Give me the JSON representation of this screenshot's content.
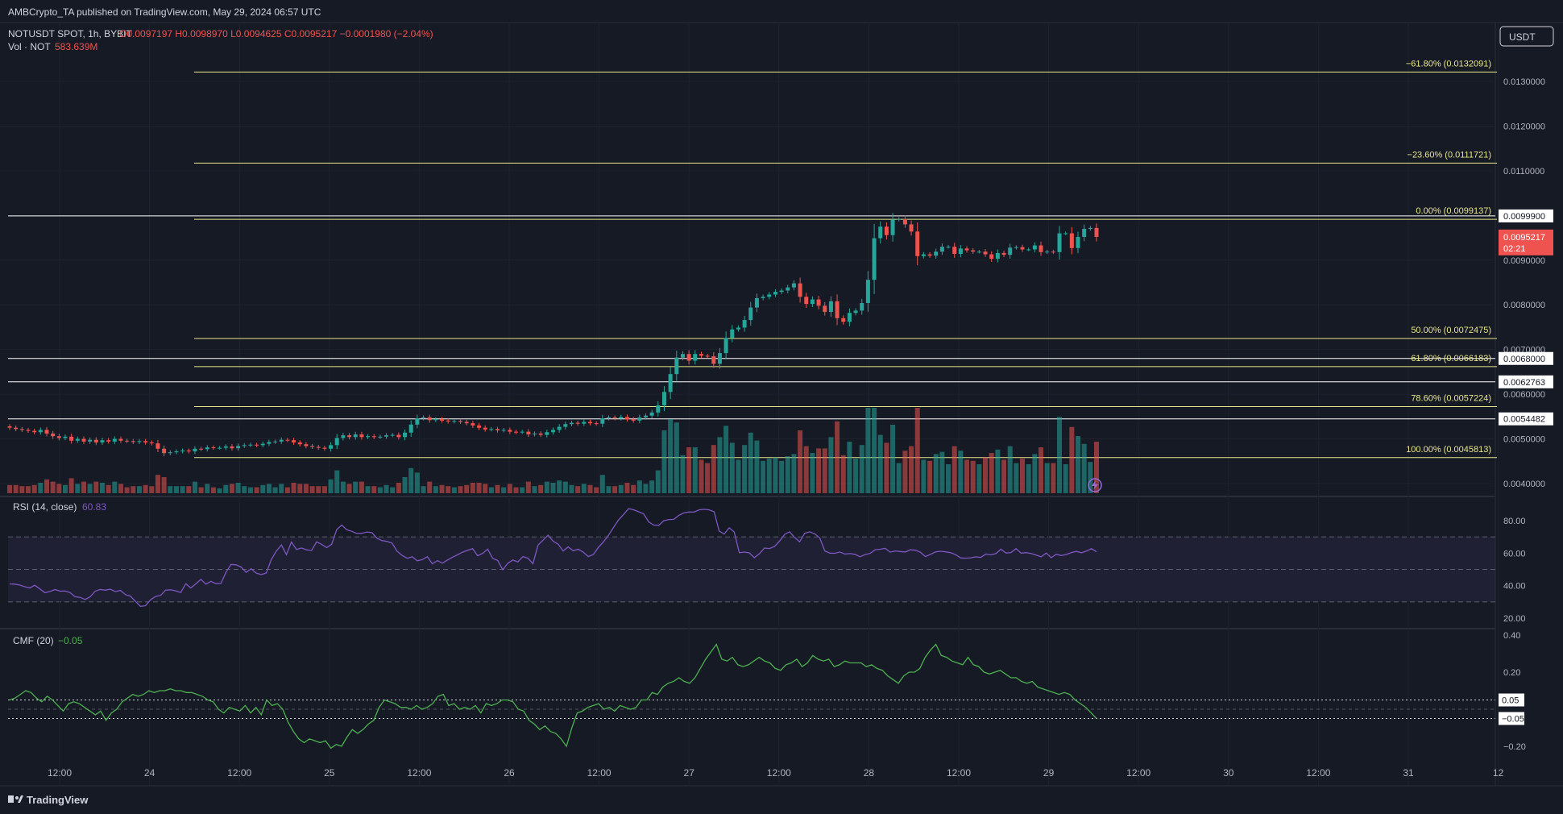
{
  "header": {
    "publisher": "AMBCrypto_TA published on TradingView.com, May 29, 2024 06:57 UTC",
    "symbol": "NOTUSDT SPOT, 1h, BYBIT",
    "ohlc": "O0.0097197 H0.0098970 L0.0094625 C0.0095217 −0.0001980 (−2.04%)",
    "vol_label": "Vol · NOT",
    "vol_value": "583.639M"
  },
  "currency": "USDT",
  "footer_brand": "TradingView",
  "colors": {
    "up": "#26a69a",
    "down": "#ef5350",
    "fib": "#e8e68a",
    "rsi": "#7e57c2",
    "cmf": "#4caf50",
    "bg": "#161a25"
  },
  "chart_data": [
    {
      "type": "candlestick",
      "title": "NOTUSDT SPOT, 1h, BYBIT",
      "y_ticks": [
        "0.0130000",
        "0.0120000",
        "0.0110000",
        "0.0090000",
        "0.0080000",
        "0.0070000",
        "0.0060000",
        "0.0050000",
        "0.0040000"
      ],
      "x_ticks": [
        "12:00",
        "24",
        "12:00",
        "25",
        "12:00",
        "26",
        "12:00",
        "27",
        "12:00",
        "28",
        "12:00",
        "29",
        "12:00",
        "30",
        "12:00",
        "31",
        "12"
      ],
      "current_price": "0.0095217",
      "countdown": "02:21",
      "price_levels": [
        "0.0099900",
        "0.0068000",
        "0.0062763",
        "0.0054482"
      ],
      "fib_levels": [
        {
          "label": "−61.80% (0.0132091)",
          "price": 0.0132091
        },
        {
          "label": "−23.60% (0.0111721)",
          "price": 0.0111721
        },
        {
          "label": "0.00% (0.0099137)",
          "price": 0.0099137
        },
        {
          "label": "50.00% (0.0072475)",
          "price": 0.0072475
        },
        {
          "label": "61.80% (0.0066183)",
          "price": 0.0066183
        },
        {
          "label": "78.60% (0.0057224)",
          "price": 0.0057224
        },
        {
          "label": "100.00% (0.0045813)",
          "price": 0.0045813
        }
      ],
      "closes": [
        0.00525,
        0.00522,
        0.0052,
        0.00518,
        0.00515,
        0.0052,
        0.00512,
        0.00506,
        0.00502,
        0.00505,
        0.00496,
        0.005,
        0.00494,
        0.00498,
        0.00492,
        0.00497,
        0.00494,
        0.005,
        0.00496,
        0.00495,
        0.00493,
        0.00495,
        0.00492,
        0.0049,
        0.00478,
        0.00468,
        0.0047,
        0.00472,
        0.00474,
        0.00472,
        0.00478,
        0.00477,
        0.00481,
        0.0048,
        0.0048,
        0.00483,
        0.00479,
        0.00484,
        0.00486,
        0.00487,
        0.00486,
        0.00489,
        0.00493,
        0.00494,
        0.00498,
        0.00497,
        0.00492,
        0.00488,
        0.00484,
        0.00482,
        0.0048,
        0.00478,
        0.00486,
        0.00502,
        0.00508,
        0.00504,
        0.0051,
        0.00504,
        0.00506,
        0.00504,
        0.00505,
        0.00508,
        0.00509,
        0.00504,
        0.00514,
        0.00532,
        0.00546,
        0.00548,
        0.00542,
        0.00544,
        0.00541,
        0.00539,
        0.0054,
        0.00538,
        0.00535,
        0.0053,
        0.00525,
        0.00521,
        0.00522,
        0.00519,
        0.0052,
        0.00516,
        0.00515,
        0.00516,
        0.0051,
        0.00512,
        0.00509,
        0.00515,
        0.0052,
        0.00527,
        0.00533,
        0.00536,
        0.00534,
        0.00538,
        0.00535,
        0.00534,
        0.00546,
        0.00548,
        0.00546,
        0.00549,
        0.00544,
        0.00541,
        0.00548,
        0.00552,
        0.00559,
        0.00575,
        0.00605,
        0.00645,
        0.00682,
        0.0069,
        0.00675,
        0.0069,
        0.00686,
        0.00685,
        0.00668,
        0.00692,
        0.00726,
        0.00745,
        0.00749,
        0.00766,
        0.00794,
        0.00815,
        0.00818,
        0.00823,
        0.00829,
        0.00832,
        0.00839,
        0.00848,
        0.00818,
        0.00802,
        0.00812,
        0.00798,
        0.00784,
        0.00808,
        0.0077,
        0.00762,
        0.00782,
        0.00787,
        0.00804,
        0.00856,
        0.00949,
        0.00975,
        0.00956,
        0.00991,
        0.00992,
        0.0098,
        0.00964,
        0.00909,
        0.00913,
        0.0091,
        0.00919,
        0.0093,
        0.0093,
        0.00914,
        0.00926,
        0.00922,
        0.00919,
        0.00919,
        0.00913,
        0.00903,
        0.00916,
        0.00912,
        0.00928,
        0.00929,
        0.00924,
        0.00924,
        0.00933,
        0.00918,
        0.00919,
        0.00918,
        0.0096,
        0.0096,
        0.00927,
        0.00952,
        0.0097,
        0.00972,
        0.00952
      ],
      "rsi": {
        "label": "RSI (14, close)",
        "value": "60.83",
        "y_ticks": [
          "80.00",
          "60.00",
          "40.00",
          "20.00"
        ],
        "values": [
          41.06,
          40.92,
          40.4,
          39.33,
          38.6,
          40.24,
          37.99,
          35.69,
          36.42,
          37.6,
          36.61,
          36.71,
          35.71,
          33.2,
          32.78,
          31.52,
          33.12,
          36.59,
          37.64,
          37.23,
          37.82,
          36.33,
          37.12,
          34.54,
          33.55,
          30.32,
          27.22,
          27.68,
          31.36,
          33.32,
          34.05,
          37.24,
          37.46,
          36.83,
          35.78,
          41.21,
          38.59,
          41.14,
          43.85,
          40.91,
          42.68,
          41.21,
          41.41,
          48.34,
          53.08,
          52.85,
          51.42,
          48.2,
          50.4,
          47.74,
          46.82,
          47.77,
          56.12,
          61.29,
          65.03,
          59.08,
          66.83,
          62.3,
          63.2,
          62.04,
          61.61,
          66.94,
          65.42,
          63.38,
          65.48,
          74.49,
          77.28,
          74.42,
          73.4,
          72.09,
          72.21,
          73.0,
          72.62,
          69.21,
          67.68,
          67.23,
          66.15,
          61.18,
          58.56,
          56.84,
          57.72,
          55.31,
          55.98,
          57.85,
          53.45,
          55.41,
          53.81,
          55.77,
          57.48,
          59.0,
          60.62,
          61.68,
          62.77,
          58.45,
          59.87,
          62.45,
          56.75,
          55.47,
          49.8,
          53.79,
          55.76,
          54.61,
          57.9,
          56.89,
          53.51,
          64.97,
          67.98,
          71.06,
          67.36,
          65.58,
          61.34,
          63.85,
          61.47,
          62.41,
          60.59,
          57.86,
          59.18,
          63.52,
          66.87,
          70.91,
          75.73,
          80.39,
          83.77,
          87.38,
          86.69,
          85.43,
          84.15,
          79.27,
          77.26,
          77.14,
          79.94,
          80.71,
          80.8,
          83.25,
          84.76,
          85.33,
          85.26,
          86.64,
          87.0,
          86.63,
          85.47,
          73.63,
          71.7,
          75.58,
          73.04,
          60.27,
          60.68,
          60.19,
          57.2,
          59.69,
          63.12,
          62.86,
          64.09,
          67.35,
          71.5,
          73.16,
          69.68,
          66.98,
          72.22,
          73.1,
          71.86,
          69.34,
          61.37,
          60.03,
          59.94,
          60.7,
          59.43,
          59.72,
          59.29,
          57.77,
          59.1,
          59.84,
          62.08,
          62.38,
          62.92,
          60.63,
          61.37,
          61.02,
          60.72,
          62.03,
          61.81,
          60.57,
          57.88,
          59.29,
          60.76,
          61.15,
          60.81,
          60.24,
          59.06,
          57.06,
          56.89,
          57.15,
          57.75,
          57.38,
          59.46,
          58.99,
          59.74,
          62.39,
          60.07,
          60.35,
          62.8,
          60.0,
          60.3,
          59.82,
          58.79,
          57.74,
          60.05,
          57.26,
          59.34,
          58.51,
          59.15,
          60.36,
          61.13,
          60.21,
          61.28,
          62.73,
          60.83
        ]
      },
      "cmf": {
        "label": "CMF (20)",
        "value": "−0.05",
        "y_ticks": [
          "0.40",
          "0.20",
          "−0.20"
        ],
        "level_labels": [
          "0.05",
          "−0.05"
        ],
        "values": [
          0.05,
          0.06,
          0.08,
          0.1,
          0.09,
          0.06,
          0.04,
          0.07,
          0.05,
          0.02,
          -0.01,
          0.03,
          0.04,
          0.03,
          0.01,
          -0.01,
          -0.03,
          -0.01,
          -0.06,
          -0.02,
          0.0,
          0.04,
          0.06,
          0.08,
          0.07,
          0.08,
          0.1,
          0.09,
          0.1,
          0.1,
          0.11,
          0.1,
          0.1,
          0.09,
          0.09,
          0.08,
          0.07,
          0.05,
          0.04,
          0.0,
          -0.02,
          0.01,
          0.0,
          -0.01,
          0.02,
          -0.02,
          0.01,
          -0.03,
          0.05,
          0.02,
          0.03,
          0.0,
          -0.07,
          -0.12,
          -0.16,
          -0.18,
          -0.16,
          -0.17,
          -0.18,
          -0.17,
          -0.21,
          -0.19,
          -0.2,
          -0.15,
          -0.11,
          -0.13,
          -0.11,
          -0.08,
          -0.06,
          0.01,
          0.05,
          0.04,
          0.03,
          0.01,
          0.01,
          0.0,
          0.02,
          0.0,
          0.01,
          0.03,
          0.07,
          0.08,
          0.02,
          0.03,
          0.0,
          0.01,
          0.0,
          0.02,
          -0.02,
          0.03,
          0.02,
          0.03,
          0.05,
          0.05,
          0.04,
          0.0,
          -0.01,
          -0.06,
          -0.08,
          -0.11,
          -0.09,
          -0.12,
          -0.13,
          -0.16,
          -0.2,
          -0.1,
          -0.02,
          -0.01,
          0.01,
          0.02,
          0.03,
          0.0,
          0.01,
          -0.01,
          0.02,
          0.01,
          0.0,
          0.01,
          0.05,
          0.05,
          0.09,
          0.08,
          0.12,
          0.14,
          0.15,
          0.17,
          0.15,
          0.14,
          0.17,
          0.22,
          0.27,
          0.31,
          0.35,
          0.27,
          0.26,
          0.28,
          0.24,
          0.23,
          0.24,
          0.26,
          0.28,
          0.26,
          0.25,
          0.22,
          0.21,
          0.24,
          0.25,
          0.27,
          0.23,
          0.25,
          0.29,
          0.27,
          0.26,
          0.27,
          0.23,
          0.24,
          0.26,
          0.25,
          0.25,
          0.25,
          0.23,
          0.24,
          0.22,
          0.21,
          0.18,
          0.16,
          0.14,
          0.18,
          0.2,
          0.2,
          0.22,
          0.28,
          0.32,
          0.35,
          0.29,
          0.28,
          0.26,
          0.25,
          0.24,
          0.28,
          0.24,
          0.23,
          0.2,
          0.19,
          0.2,
          0.21,
          0.19,
          0.17,
          0.17,
          0.15,
          0.14,
          0.15,
          0.12,
          0.11,
          0.1,
          0.09,
          0.08,
          0.09,
          0.08,
          0.05,
          0.03,
          0.01,
          -0.02,
          -0.05
        ]
      }
    }
  ]
}
